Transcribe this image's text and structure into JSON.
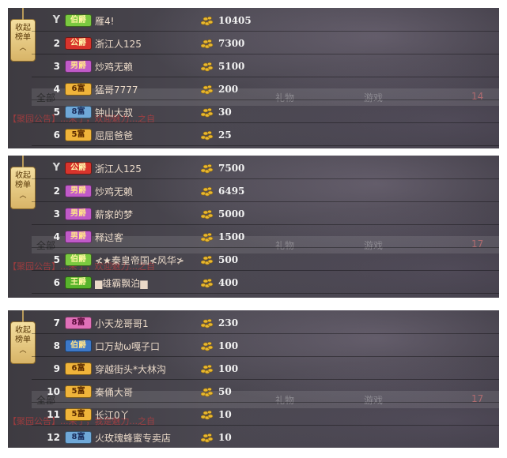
{
  "collapse_label": "收起榜单",
  "collapse_caret": "︿",
  "trophy_glyph": "Y",
  "background_text": {
    "qbj": "全部",
    "tab2": "礼物",
    "tab3": "游戏",
    "count_a": "14",
    "count_b": "17",
    "hint1": "【聚园公告】...来了，欢迎魅力...之自",
    "hint2": "【聚园公告】...来了，我是魅力...之自"
  },
  "colors": {
    "badge_green": "#7ac940",
    "badge_red": "#d8342c",
    "badge_purple": "#c05ac8",
    "badge_gold": "#f0b43a",
    "badge_blue": "#6fa8d8",
    "badge_pink": "#e070b8",
    "badge_blue_dark": "#3c78c8",
    "badge_lime": "#58b42c",
    "coin": "#e8b830"
  },
  "panels": [
    {
      "rows": [
        {
          "rank": "",
          "trophy": true,
          "badge": "伯爵",
          "badge_color": "green",
          "name": "雁4!",
          "value": "10405"
        },
        {
          "rank": "2",
          "badge": "公爵",
          "badge_color": "red",
          "name": "浙江人125",
          "value": "7300"
        },
        {
          "rank": "3",
          "badge": "男爵",
          "badge_color": "purple",
          "name": "炒鸡无赖",
          "value": "5100"
        },
        {
          "rank": "4",
          "badge": "6富",
          "badge_color": "gold",
          "name": "猛哥7777",
          "value": "200"
        },
        {
          "rank": "5",
          "badge": "8富",
          "badge_color": "blue",
          "name": "钟山大叔",
          "value": "30"
        },
        {
          "rank": "6",
          "badge": "5富",
          "badge_color": "gold",
          "name": "屈屈爸爸",
          "value": "25"
        }
      ]
    },
    {
      "rows": [
        {
          "rank": "",
          "trophy": true,
          "badge": "公爵",
          "badge_color": "red",
          "name": "浙江人125",
          "value": "7500"
        },
        {
          "rank": "2",
          "badge": "男爵",
          "badge_color": "purple",
          "name": "炒鸡无赖",
          "value": "6495"
        },
        {
          "rank": "3",
          "badge": "男爵",
          "badge_color": "purple",
          "name": "薪家的梦",
          "value": "5000"
        },
        {
          "rank": "4",
          "badge": "男爵",
          "badge_color": "purple",
          "name": "释过客",
          "value": "1500"
        },
        {
          "rank": "5",
          "badge": "伯爵",
          "badge_color": "green",
          "name": "≮★秦皇帝国≮风华≯",
          "value": "500"
        },
        {
          "rank": "6",
          "badge": "王爵",
          "badge_color": "lime",
          "name": "▆雄霸飘泊▆",
          "value": "400"
        }
      ]
    },
    {
      "rows": [
        {
          "rank": "7",
          "badge": "8富",
          "badge_color": "pink",
          "name": "小天龙哥哥1",
          "value": "230"
        },
        {
          "rank": "8",
          "badge": "伯爵",
          "badge_color": "blue_dark",
          "name": "口万劫ω嘎子口",
          "value": "100"
        },
        {
          "rank": "9",
          "badge": "6富",
          "badge_color": "gold",
          "name": "穿越街头*大林沟",
          "value": "100"
        },
        {
          "rank": "10",
          "badge": "5富",
          "badge_color": "gold",
          "name": "秦俑大哥",
          "value": "50"
        },
        {
          "rank": "11",
          "badge": "5富",
          "badge_color": "gold",
          "name": "长江0丫",
          "value": "10"
        },
        {
          "rank": "12",
          "badge": "8富",
          "badge_color": "blue",
          "name": "火玫瑰蜂蜜专卖店",
          "value": "10"
        }
      ]
    }
  ]
}
